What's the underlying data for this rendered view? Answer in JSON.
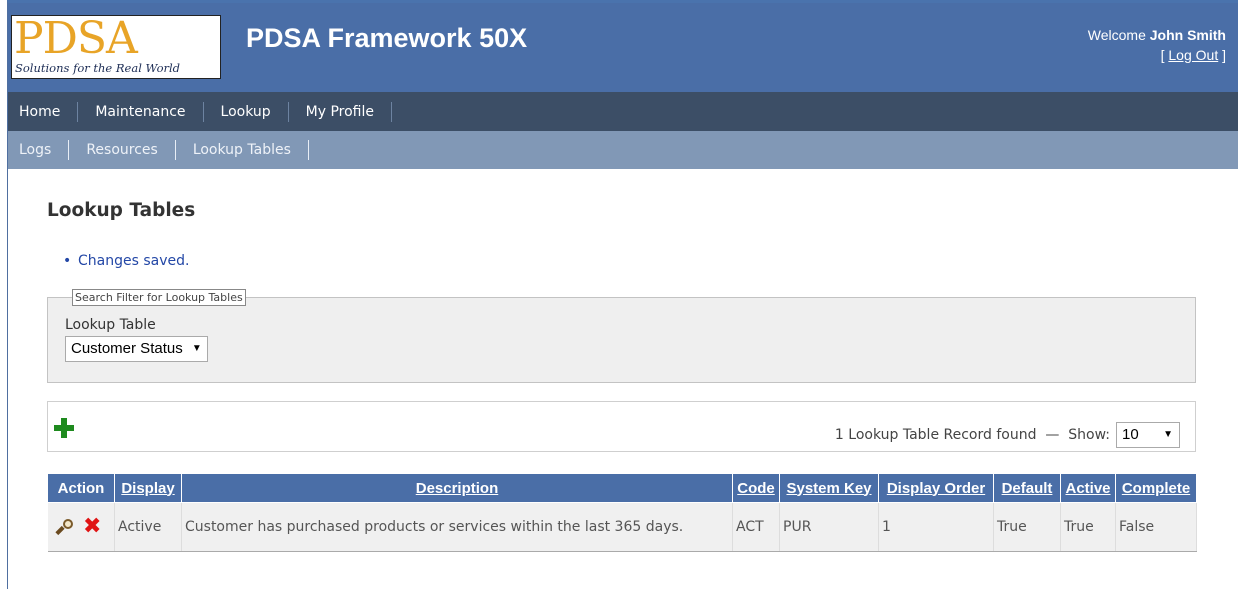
{
  "header": {
    "logo_text": "PDSA",
    "logo_tagline": "Solutions for the Real World",
    "app_title": "PDSA Framework 50X",
    "welcome_prefix": "Welcome",
    "user_name": "John Smith",
    "logout_open": "[",
    "logout_label": "Log Out",
    "logout_close": "]"
  },
  "menu": [
    "Home",
    "Maintenance",
    "Lookup",
    "My Profile"
  ],
  "submenu": [
    "Logs",
    "Resources",
    "Lookup Tables"
  ],
  "page": {
    "title": "Lookup Tables",
    "message": "Changes saved."
  },
  "filter": {
    "legend": "Search Filter for Lookup Tables",
    "lookup_label": "Lookup Table",
    "lookup_value": "Customer Status"
  },
  "toolbar": {
    "found_text": "1 Lookup Table Record found",
    "separator": "—",
    "show_label": "Show:",
    "show_value": "10"
  },
  "table": {
    "headers": [
      "Action",
      "Display",
      "Description",
      "Code",
      "System Key",
      "Display Order",
      "Default",
      "Active",
      "Complete"
    ],
    "rows": [
      {
        "display": "Active",
        "description": "Customer has purchased products or services within the last 365 days.",
        "code": "ACT",
        "system_key": "PUR",
        "display_order": "1",
        "default": "True",
        "active": "True",
        "complete": "False"
      }
    ]
  },
  "icons": {
    "add": "plus-icon",
    "edit": "magnifier-icon",
    "delete": "delete-x-icon"
  },
  "colors": {
    "header_bg": "#4a6ea7",
    "menu_bg": "#3c4e66",
    "submenu_bg": "#8198b6",
    "message": "#2347a6",
    "add_icon": "#1e8a1e",
    "delete_icon": "#e01414"
  }
}
